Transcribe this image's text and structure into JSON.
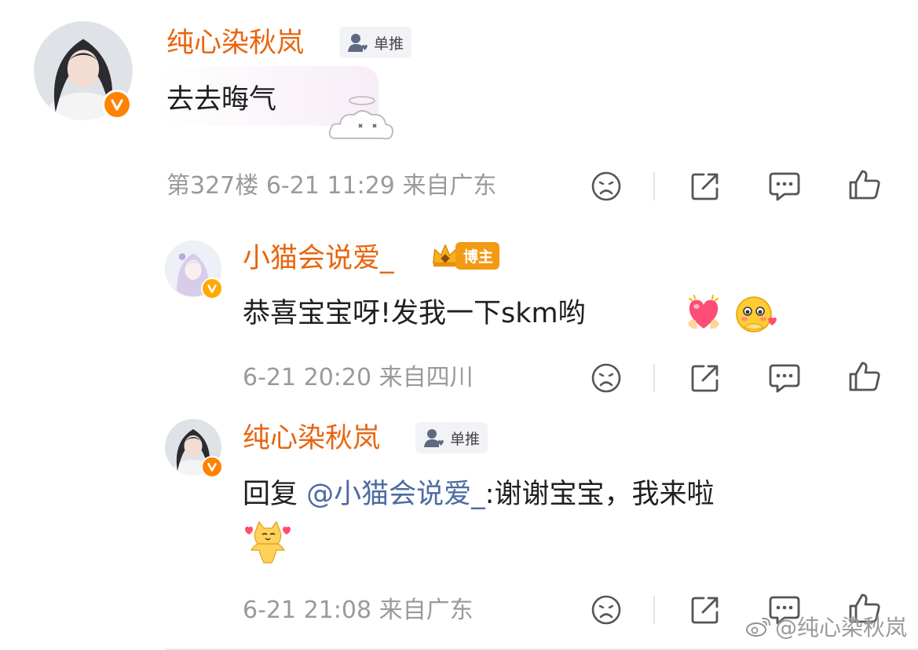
{
  "comment": {
    "username": "纯心染秋岚",
    "tag": "单推",
    "text": "去去晦气",
    "floor": "第327楼",
    "time": "6-21 11:29",
    "location": "来自广东"
  },
  "replies": [
    {
      "username": "小猫会说爱_",
      "badge": "博主",
      "text": "恭喜宝宝呀!发我一下skm哟",
      "time": "6-21 20:20",
      "location": "来自四川"
    },
    {
      "username": "纯心染秋岚",
      "tag": "单推",
      "prefix": "回复 ",
      "mention": "@小猫会说爱_",
      "text": ":谢谢宝宝，我来啦",
      "time": "6-21 21:08",
      "location": "来自广东"
    }
  ],
  "watermark": "@纯心染秋岚",
  "colors": {
    "username": "#e8650f",
    "mention": "#4d6ba3",
    "meta": "#9a9a9a",
    "verified": "#ff8200",
    "blogger_badge": "#f39a14"
  },
  "icons": [
    "dislike-icon",
    "share-icon",
    "comment-icon",
    "like-icon",
    "verified-icon",
    "fan-tag-icon",
    "crown-icon",
    "weibo-logo-icon"
  ]
}
